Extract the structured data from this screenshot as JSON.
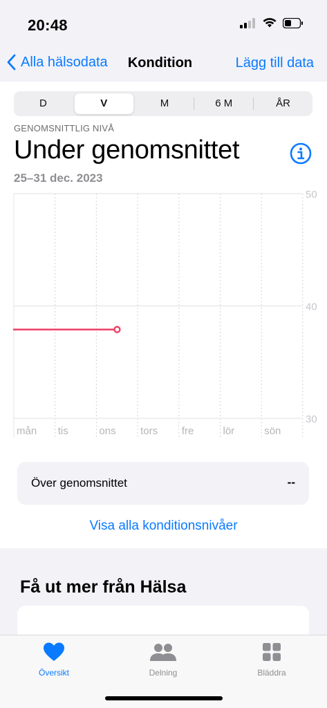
{
  "status_bar": {
    "time": "20:48"
  },
  "nav": {
    "back_label": "Alla hälsodata",
    "title": "Kondition",
    "action_label": "Lägg till data"
  },
  "segments": [
    {
      "label": "D",
      "active": false
    },
    {
      "label": "V",
      "active": true
    },
    {
      "label": "M",
      "active": false
    },
    {
      "label": "6 M",
      "active": false
    },
    {
      "label": "ÅR",
      "active": false
    }
  ],
  "summary": {
    "kicker": "GENOMSNITTLIG NIVÅ",
    "headline": "Under genomsnittet",
    "date_range": "25–31 dec. 2023"
  },
  "chart_data": {
    "type": "line",
    "categories": [
      "mån",
      "tis",
      "ons",
      "tors",
      "fre",
      "lör",
      "sön"
    ],
    "y_ticks": [
      30,
      40,
      50
    ],
    "ylim": [
      30,
      50
    ],
    "series": [
      {
        "values": [
          37.9,
          37.9,
          37.9,
          null,
          null,
          null,
          null
        ],
        "color": "#ee3e64"
      }
    ],
    "grid": true
  },
  "level_card": {
    "label": "Över genomsnittet",
    "value": "--"
  },
  "all_levels_link": "Visa alla konditionsnivåer",
  "more_section": {
    "title": "Få ut mer från Hälsa"
  },
  "tabs": {
    "overview": "Översikt",
    "sharing": "Delning",
    "browse": "Bläddra"
  },
  "colors": {
    "accent": "#0a7aff",
    "series": "#ee3e64"
  }
}
